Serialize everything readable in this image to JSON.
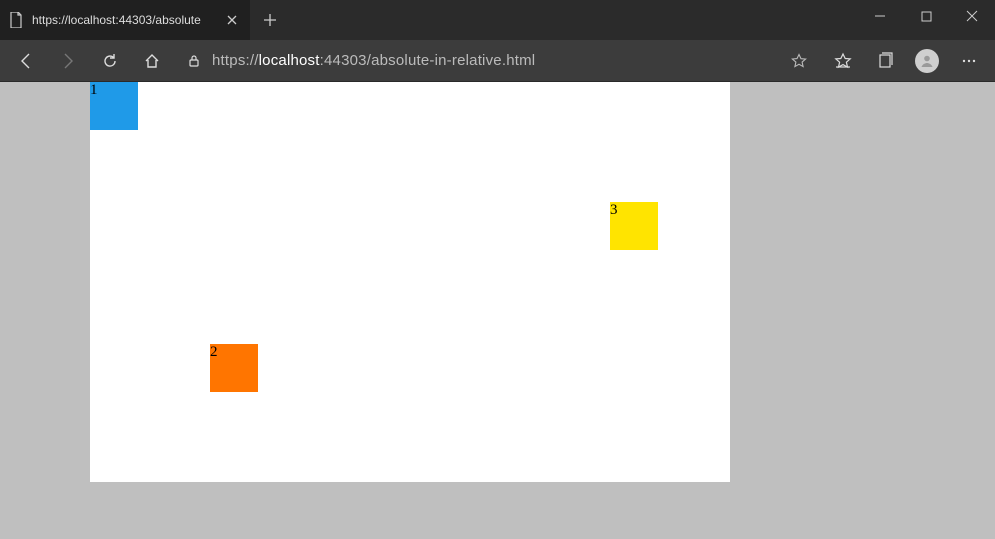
{
  "browser": {
    "tab_title": "https://localhost:44303/absolute",
    "url_protocol": "https://",
    "url_host": "localhost",
    "url_port": ":44303",
    "url_path": "/absolute-in-relative.html"
  },
  "page": {
    "boxes": [
      {
        "label": "1"
      },
      {
        "label": "2"
      },
      {
        "label": "3"
      }
    ]
  }
}
